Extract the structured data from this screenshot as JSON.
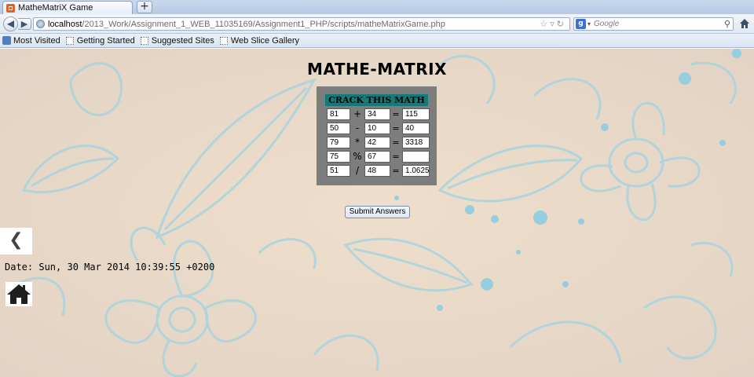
{
  "browser": {
    "tab_title": "MatheMatriX Game",
    "new_tab_label": "+",
    "url_host": "localhost",
    "url_path": "/2013_Work/Assignment_1_WEB_11035169/Assignment1_PHP/scripts/matheMatrixGame.php",
    "search_placeholder": "Google",
    "bookmarks": [
      "Most Visited",
      "Getting Started",
      "Suggested Sites",
      "Web Slice Gallery"
    ]
  },
  "page": {
    "title": "MATHE-MATRIX",
    "matrix_heading": "CRACK THIS MATH",
    "rows": [
      {
        "a": "81",
        "op": "+",
        "b": "34",
        "eq": "=",
        "answer": "115"
      },
      {
        "a": "50",
        "op": "-",
        "b": "10",
        "eq": "=",
        "answer": "40"
      },
      {
        "a": "79",
        "op": "*",
        "b": "42",
        "eq": "=",
        "answer": "3318"
      },
      {
        "a": "75",
        "op": "%",
        "b": "67",
        "eq": "=",
        "answer": ""
      },
      {
        "a": "51",
        "op": "/",
        "b": "48",
        "eq": "=",
        "answer": "1.0625"
      }
    ],
    "submit_label": "Submit Answers",
    "back_label": "❮",
    "date": "Date: Sun, 30 Mar 2014 10:39:55 +0200"
  },
  "colors": {
    "page_background": "#e8d6c0",
    "pattern_lines": "#9fd4e4",
    "matrix_panel": "#7d7d7d",
    "matrix_heading": "#137a78"
  }
}
